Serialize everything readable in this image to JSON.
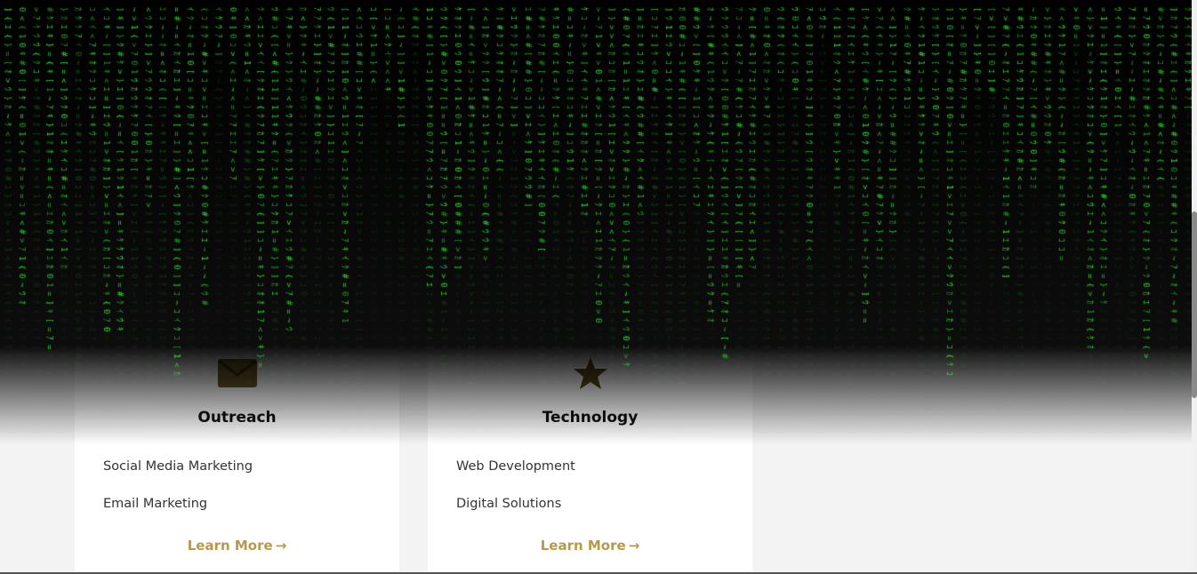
{
  "cards": [
    {
      "title": "Outreach",
      "icon": "envelope-icon",
      "items": [
        "Social Media Marketing",
        "Email Marketing"
      ],
      "cta": "Learn More",
      "cta_arrow": "→"
    },
    {
      "title": "Technology",
      "icon": "star-icon",
      "items": [
        "Web Development",
        "Digital Solutions"
      ],
      "cta": "Learn More",
      "cta_arrow": "→"
    }
  ],
  "colors": {
    "accent": "#b59a4e",
    "matrix_green": "#33ff33",
    "background": "#f3f3f3"
  }
}
